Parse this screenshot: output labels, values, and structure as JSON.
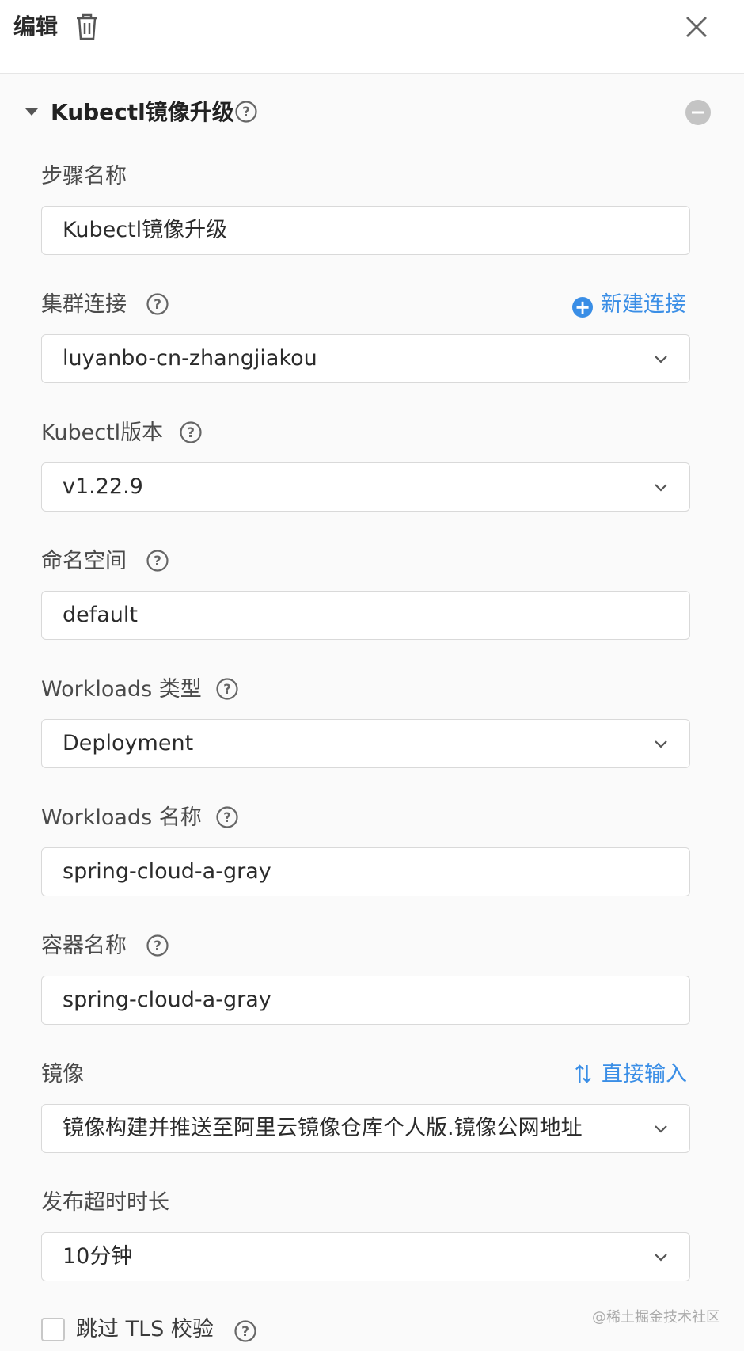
{
  "header": {
    "title": "编辑",
    "trash_icon": "trash-icon",
    "close_icon": "close-icon"
  },
  "section": {
    "title": "Kubectl镜像升级"
  },
  "fields": {
    "step_name": {
      "label": "步骤名称",
      "value": "Kubectl镜像升级"
    },
    "cluster": {
      "label": "集群连接",
      "value": "luyanbo-cn-zhangjiakou",
      "action": "新建连接"
    },
    "kubectl_version": {
      "label": "Kubectl版本",
      "value": "v1.22.9"
    },
    "namespace": {
      "label": "命名空间",
      "value": "default"
    },
    "workload_type": {
      "label": "Workloads 类型",
      "value": "Deployment"
    },
    "workload_name": {
      "label": "Workloads 名称",
      "value": "spring-cloud-a-gray"
    },
    "container_name": {
      "label": "容器名称",
      "value": "spring-cloud-a-gray"
    },
    "image": {
      "label": "镜像",
      "value": "镜像构建并推送至阿里云镜像仓库个人版.镜像公网地址",
      "action": "直接输入"
    },
    "timeout": {
      "label": "发布超时时长",
      "value": "10分钟"
    }
  },
  "skip_tls": {
    "label": "跳过 TLS 校验",
    "checked": false
  },
  "watermark": "@稀土掘金技术社区",
  "colors": {
    "accent": "#3a8ee6",
    "border": "#d9d9d9",
    "background": "#fafafa"
  }
}
